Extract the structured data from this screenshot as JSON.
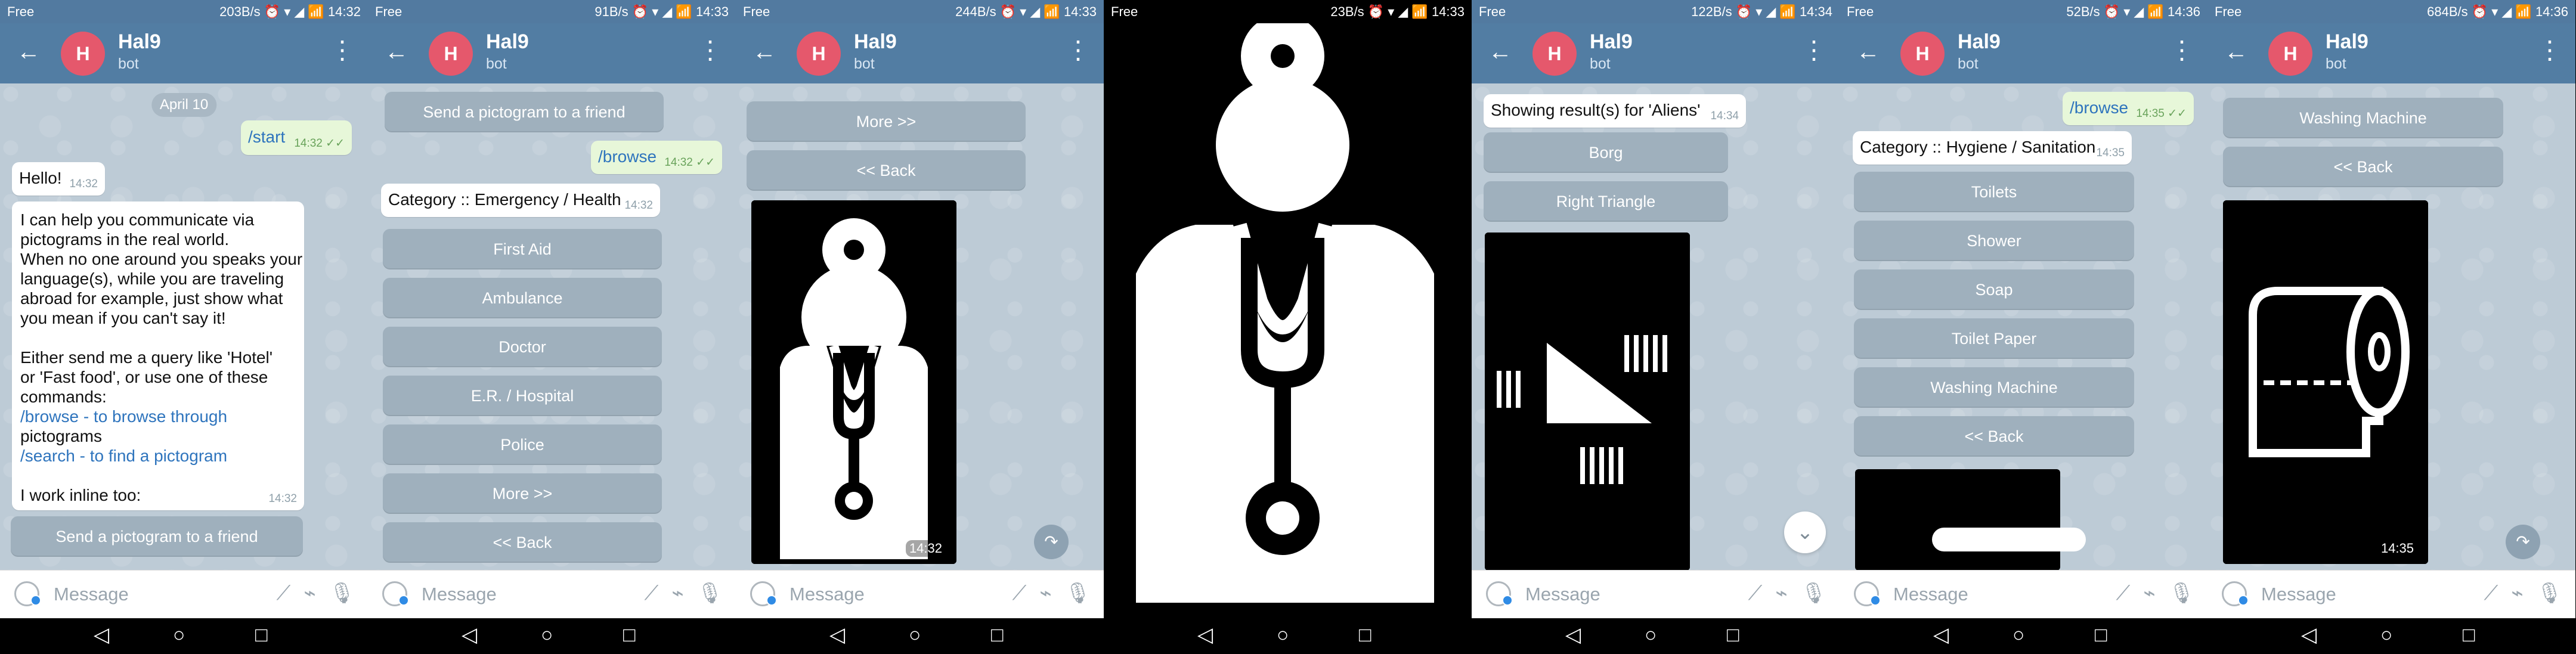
{
  "common": {
    "bot_name": "Hal9",
    "bot_subtitle": "bot",
    "avatar_letter": "H",
    "message_placeholder": "Message",
    "icons": [
      "back-arrow-icon",
      "more-vertical-icon",
      "smile-icon",
      "slash-command-icon",
      "attach-icon",
      "microphone-icon",
      "nav-back-icon",
      "nav-home-icon",
      "nav-recents-icon",
      "share-icon",
      "scroll-down-icon",
      "doctor-pictogram-icon",
      "alien-pictogram-icon",
      "toilet-paper-pictogram-icon"
    ]
  },
  "screens": [
    {
      "status": {
        "carrier": "Free",
        "right": "203B/s ⏰ ▾ ◢ 📶 14:32"
      },
      "date_chip": "April 10",
      "out_start": {
        "text": "/start",
        "time": "14:32 ✓✓"
      },
      "hello": {
        "text": "Hello!",
        "time": "14:32"
      },
      "intro_lines": [
        "I can help you communicate via",
        "pictograms in the real world.",
        "When no one around you speaks your",
        "language(s), while you are traveling",
        "abroad for example, just show what",
        "you mean if you can't say it!",
        "",
        "Either send me a query like 'Hotel'",
        "or 'Fast food', or use one of these",
        "commands:",
        "/browse - to browse through",
        "pictograms",
        "/search - to find a pictogram",
        "",
        "I work inline too:"
      ],
      "intro_time": "14:32",
      "send_button": "Send a pictogram to a friend"
    },
    {
      "status": {
        "carrier": "Free",
        "right": "91B/s ⏰ ▾ ◢ 📶 14:33"
      },
      "send_button": "Send a pictogram to a friend",
      "browse": {
        "text": "/browse",
        "time": "14:32 ✓✓"
      },
      "category": {
        "text": "Category :: Emergency / Health",
        "time": "14:32"
      },
      "buttons": [
        "First Aid",
        "Ambulance",
        "Doctor",
        "E.R. / Hospital",
        "Police",
        "More >>",
        "<< Back"
      ]
    },
    {
      "status": {
        "carrier": "Free",
        "right": "244B/s ⏰ ▾ ◢ 📶 14:33"
      },
      "buttons": [
        "More >>",
        "<< Back"
      ],
      "image_time": "14:32"
    },
    {
      "status": {
        "carrier": "Free",
        "right": "23B/s ⏰ ▾ ◢ 📶 14:33"
      }
    },
    {
      "status": {
        "carrier": "Free",
        "right": "122B/s ⏰ ▾ ◢ 📶 14:34"
      },
      "result": {
        "text": "Showing result(s) for 'Aliens'",
        "time": "14:34"
      },
      "buttons": [
        "Borg",
        "Right Triangle"
      ]
    },
    {
      "status": {
        "carrier": "Free",
        "right": "52B/s ⏰ ▾ ◢ 📶 14:36"
      },
      "browse": {
        "text": "/browse",
        "time": "14:35 ✓✓"
      },
      "category": {
        "text": "Category :: Hygiene / Sanitation",
        "time": "14:35"
      },
      "buttons": [
        "Toilets",
        "Shower",
        "Soap",
        "Toilet Paper",
        "Washing Machine",
        "<< Back"
      ]
    },
    {
      "status": {
        "carrier": "Free",
        "right": "684B/s ⏰ ▾ ◢ 📶 14:36"
      },
      "buttons": [
        "Washing Machine",
        "<< Back"
      ],
      "image_time": "14:35"
    }
  ]
}
